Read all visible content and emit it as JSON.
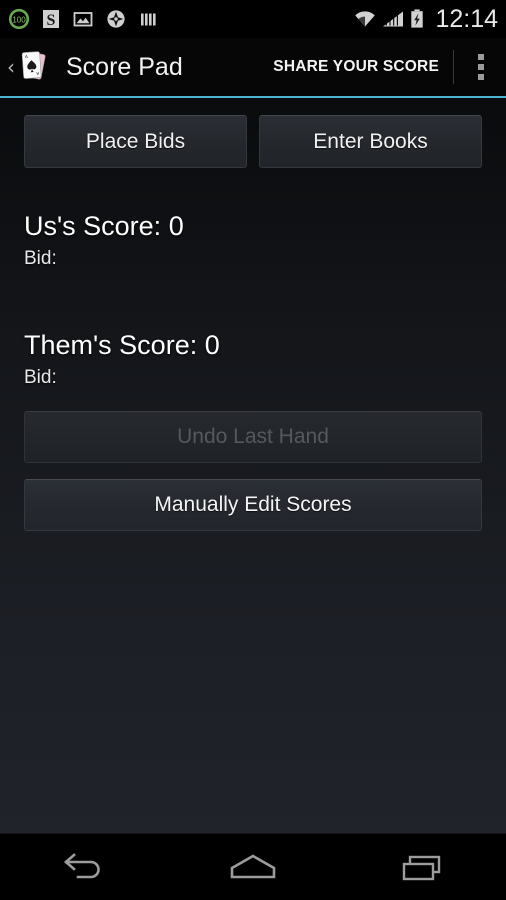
{
  "status_bar": {
    "icons": [
      {
        "name": "battery-100-circle-icon",
        "label": "100"
      },
      {
        "name": "s-app-icon",
        "label": "S"
      },
      {
        "name": "photo-gallery-icon",
        "label": ""
      },
      {
        "name": "compass-navigation-icon",
        "label": ""
      },
      {
        "name": "signal-bars-app-icon",
        "label": ""
      }
    ],
    "right_icons": [
      {
        "name": "wifi-icon"
      },
      {
        "name": "cellular-signal-icon"
      },
      {
        "name": "battery-charging-icon"
      }
    ],
    "time": "12:14",
    "accent": "#4eb3d4"
  },
  "action_bar": {
    "up_chevron": "‹",
    "app_icon_name": "playing-cards-icon",
    "title": "Score Pad",
    "action_label": "SHARE YOUR SCORE",
    "overflow_name": "overflow-menu-icon",
    "underline_color": "#4eb3d4"
  },
  "main": {
    "top_buttons": [
      {
        "label": "Place Bids",
        "name": "place-bids-button"
      },
      {
        "label": "Enter Books",
        "name": "enter-books-button"
      }
    ],
    "teams": [
      {
        "score_label": "Us's Score: 0",
        "name": "Us",
        "score": 0,
        "bid_label": "Bid:",
        "bid_value": ""
      },
      {
        "score_label": "Them's Score: 0",
        "name": "Them",
        "score": 0,
        "bid_label": "Bid:",
        "bid_value": ""
      }
    ],
    "undo_button": {
      "label": "Undo Last Hand",
      "enabled": false
    },
    "edit_button": {
      "label": "Manually Edit Scores",
      "enabled": true
    }
  },
  "nav_bar": {
    "back": "back-nav-icon",
    "home": "home-nav-icon",
    "recents": "recents-nav-icon"
  }
}
